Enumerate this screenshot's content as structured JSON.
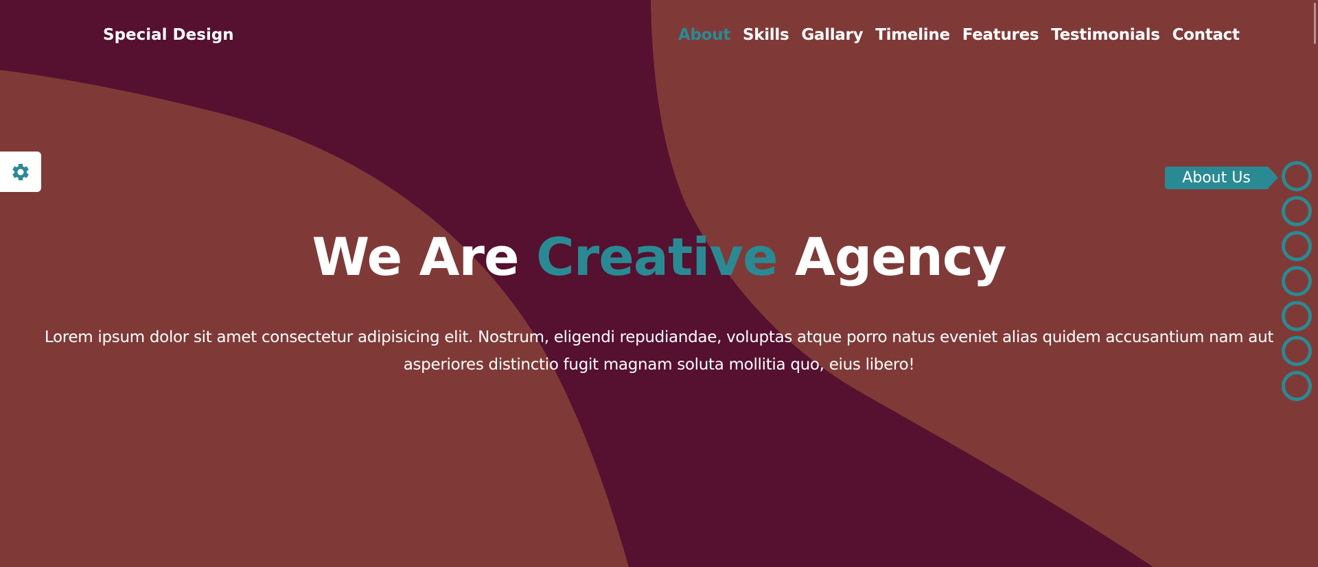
{
  "header": {
    "logo": "Special Design",
    "nav": [
      {
        "label": "About",
        "active": true
      },
      {
        "label": "Skills",
        "active": false
      },
      {
        "label": "Gallary",
        "active": false
      },
      {
        "label": "Timeline",
        "active": false
      },
      {
        "label": "Features",
        "active": false
      },
      {
        "label": "Testimonials",
        "active": false
      },
      {
        "label": "Contact",
        "active": false
      }
    ]
  },
  "hero": {
    "title_part1": "We Are",
    "title_accent": "Creative",
    "title_part2": "Agency",
    "text": "Lorem ipsum dolor sit amet consectetur adipisicing elit. Nostrum, eligendi repudiandae, voluptas atque porro natus eveniet alias quidem accusantium nam aut asperiores distinctio fugit magnam soluta mollitia quo, eius libero!"
  },
  "nav_bullets": {
    "count": 7,
    "tooltip": "About Us"
  },
  "settings": {
    "icon": "gear-icon"
  },
  "colors": {
    "background": "#7f3a37",
    "shape": "#561030",
    "accent": "#2a8a93",
    "text": "#ffffff"
  }
}
